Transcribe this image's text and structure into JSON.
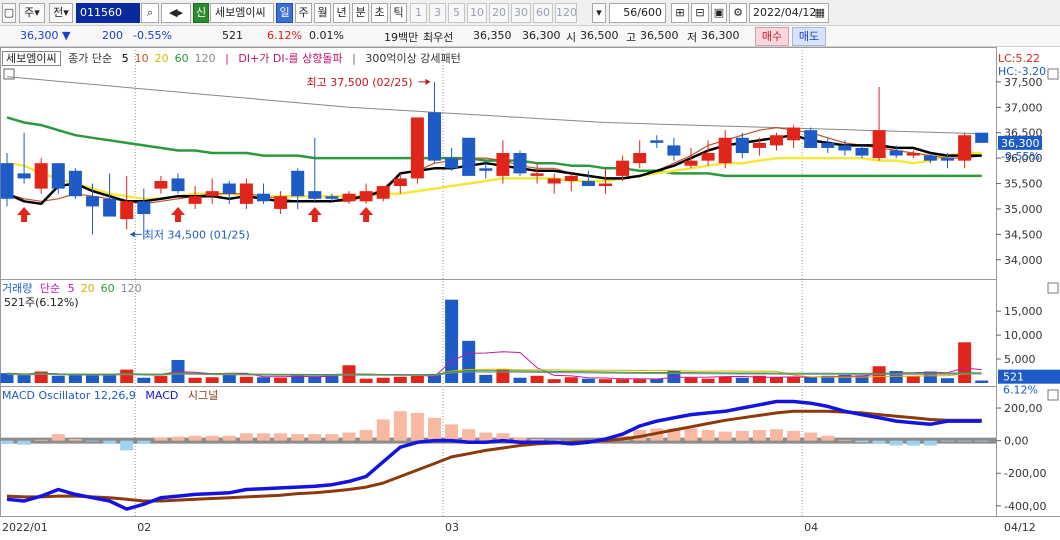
{
  "toolbar": {
    "market": "주",
    "type": "전",
    "code": "011560",
    "credit_badge": "신",
    "stock_name": "세보엠이씨",
    "period_tabs": [
      "일",
      "주",
      "월",
      "년",
      "분",
      "초",
      "틱"
    ],
    "selected_period": "일",
    "interval_buttons": [
      "1",
      "3",
      "5",
      "10",
      "20",
      "30",
      "60",
      "120"
    ],
    "count": "56/600",
    "date": "2022/04/12"
  },
  "quote": {
    "price": "36,300",
    "direction": "▼",
    "change": "200",
    "change_pct": "-0.55%",
    "volume": "521",
    "volume_pct": "6.12%",
    "turnover_pct": "0.01%",
    "unit": "19백만",
    "best_ask_label": "최우선",
    "best_ask": "36,350",
    "best_bid": "36,300",
    "open_label": "시",
    "open": "36,500",
    "high_label": "고",
    "high": "36,500",
    "low_label": "저",
    "low": "36,300",
    "buy_label": "매수",
    "sell_label": "매도"
  },
  "price_legend": {
    "name": "세보엠이씨",
    "ma_label": "종가 단순",
    "ma_periods": [
      "5",
      "10",
      "20",
      "60",
      "120"
    ],
    "signal1": "DI+가 DI-를 상향돌파",
    "signal2": "300억이상 강세패턴"
  },
  "volume_legend": {
    "label": "거래량",
    "ma_label": "단순",
    "ma_periods": [
      "5",
      "20",
      "60",
      "120"
    ],
    "current": "521주(6.12%)"
  },
  "macd_legend": {
    "label": "MACD Oscillator 12,26,9",
    "macd": "MACD",
    "signal": "시그널"
  },
  "right_labels": {
    "lc": "LC:5.22",
    "hc": "HC:-3.20",
    "price_tag": "36,300",
    "price_tag_pct": "-0.55%",
    "volume_tag": "521",
    "volume_tag_pct": "6.12%"
  },
  "annotations": {
    "high": "최고 37,500 (02/25)",
    "low": "최저 34,500 (01/25)"
  },
  "colors": {
    "up": "#e0251b",
    "down": "#1e5bc6",
    "ma5": "#000000",
    "ma10": "#c0502a",
    "ma20": "#f5e83a",
    "ma60": "#2c9a3c",
    "ma120": "#888888",
    "macd": "#1414e0",
    "signal": "#8b3a0c",
    "osc_pos": "#f7b9a2",
    "osc_neg": "#9fd2ef"
  },
  "chart_data": {
    "type": "candlestick",
    "price_axis": {
      "ticks": [
        34000,
        34500,
        35000,
        35500,
        36000,
        36500,
        37000,
        37500
      ],
      "tick_labels": [
        "34,000",
        "34,500",
        "35,000",
        "35,500",
        "36,000",
        "36,500",
        "37,000",
        "37,500"
      ],
      "range": [
        33700,
        37950
      ]
    },
    "volume_axis": {
      "ticks": [
        5000,
        10000,
        15000
      ],
      "tick_labels": [
        "5,000",
        "10,000",
        "15,000"
      ],
      "range": [
        0,
        19000
      ]
    },
    "macd_axis": {
      "ticks": [
        -400,
        -200,
        0,
        200
      ],
      "tick_labels": [
        "-400,00",
        "-200,00",
        "0,00",
        "200,00"
      ],
      "range": [
        -450,
        280
      ]
    },
    "date_axis": {
      "labels": [
        {
          "text": "2022/01",
          "index": -1
        },
        {
          "text": "02",
          "index": 8
        },
        {
          "text": "03",
          "index": 26
        },
        {
          "text": "04",
          "index": 47
        },
        {
          "text": "04/12",
          "index": 58
        }
      ]
    },
    "candles": [
      {
        "o": 35900,
        "h": 36100,
        "l": 35050,
        "c": 35200
      },
      {
        "o": 35700,
        "h": 36500,
        "l": 35500,
        "c": 35600
      },
      {
        "o": 35400,
        "h": 36000,
        "l": 35300,
        "c": 35900
      },
      {
        "o": 35900,
        "h": 35900,
        "l": 35300,
        "c": 35400
      },
      {
        "o": 35750,
        "h": 35800,
        "l": 35200,
        "c": 35250
      },
      {
        "o": 35250,
        "h": 35500,
        "l": 34500,
        "c": 35050
      },
      {
        "o": 35200,
        "h": 35700,
        "l": 35100,
        "c": 34850
      },
      {
        "o": 34800,
        "h": 35650,
        "l": 34600,
        "c": 35150
      },
      {
        "o": 35150,
        "h": 35400,
        "l": 34400,
        "c": 34900
      },
      {
        "o": 35400,
        "h": 35650,
        "l": 35300,
        "c": 35550
      },
      {
        "o": 35600,
        "h": 35700,
        "l": 35300,
        "c": 35350
      },
      {
        "o": 35100,
        "h": 35450,
        "l": 35000,
        "c": 35250
      },
      {
        "o": 35250,
        "h": 35600,
        "l": 35100,
        "c": 35350
      },
      {
        "o": 35500,
        "h": 35550,
        "l": 35100,
        "c": 35300
      },
      {
        "o": 35100,
        "h": 35600,
        "l": 35000,
        "c": 35500
      },
      {
        "o": 35300,
        "h": 35500,
        "l": 35100,
        "c": 35150
      },
      {
        "o": 35000,
        "h": 35350,
        "l": 34900,
        "c": 35250
      },
      {
        "o": 35750,
        "h": 35800,
        "l": 35000,
        "c": 35250
      },
      {
        "o": 35350,
        "h": 36400,
        "l": 35150,
        "c": 35200
      },
      {
        "o": 35250,
        "h": 35300,
        "l": 35150,
        "c": 35200
      },
      {
        "o": 35150,
        "h": 35350,
        "l": 35100,
        "c": 35300
      },
      {
        "o": 35150,
        "h": 35500,
        "l": 35100,
        "c": 35350
      },
      {
        "o": 35200,
        "h": 35400,
        "l": 35150,
        "c": 35450
      },
      {
        "o": 35450,
        "h": 35700,
        "l": 35300,
        "c": 35600
      },
      {
        "o": 35600,
        "h": 36100,
        "l": 35500,
        "c": 36800
      },
      {
        "o": 36900,
        "h": 37500,
        "l": 35900,
        "c": 35950
      },
      {
        "o": 36000,
        "h": 36200,
        "l": 35750,
        "c": 35800
      },
      {
        "o": 36400,
        "h": 36400,
        "l": 35800,
        "c": 35650
      },
      {
        "o": 35800,
        "h": 35950,
        "l": 35600,
        "c": 35750
      },
      {
        "o": 35650,
        "h": 36350,
        "l": 35500,
        "c": 36100
      },
      {
        "o": 36100,
        "h": 36150,
        "l": 35650,
        "c": 35700
      },
      {
        "o": 35650,
        "h": 35900,
        "l": 35500,
        "c": 35700
      },
      {
        "o": 35500,
        "h": 35700,
        "l": 35300,
        "c": 35600
      },
      {
        "o": 35550,
        "h": 35700,
        "l": 35350,
        "c": 35650
      },
      {
        "o": 35550,
        "h": 35750,
        "l": 35450,
        "c": 35450
      },
      {
        "o": 35450,
        "h": 35800,
        "l": 35300,
        "c": 35500
      },
      {
        "o": 35650,
        "h": 36050,
        "l": 35550,
        "c": 35950
      },
      {
        "o": 35900,
        "h": 36350,
        "l": 35800,
        "c": 36100
      },
      {
        "o": 36350,
        "h": 36450,
        "l": 36200,
        "c": 36300
      },
      {
        "o": 36250,
        "h": 36400,
        "l": 35950,
        "c": 36050
      },
      {
        "o": 35850,
        "h": 36200,
        "l": 35800,
        "c": 35950
      },
      {
        "o": 35950,
        "h": 36350,
        "l": 35850,
        "c": 36100
      },
      {
        "o": 35900,
        "h": 36550,
        "l": 35800,
        "c": 36400
      },
      {
        "o": 36400,
        "h": 36500,
        "l": 36000,
        "c": 36100
      },
      {
        "o": 36200,
        "h": 36400,
        "l": 36050,
        "c": 36300
      },
      {
        "o": 36250,
        "h": 36500,
        "l": 36150,
        "c": 36450
      },
      {
        "o": 36350,
        "h": 36650,
        "l": 36200,
        "c": 36600
      },
      {
        "o": 36550,
        "h": 36600,
        "l": 36200,
        "c": 36200
      },
      {
        "o": 36300,
        "h": 36400,
        "l": 36100,
        "c": 36200
      },
      {
        "o": 36250,
        "h": 36350,
        "l": 36050,
        "c": 36150
      },
      {
        "o": 36200,
        "h": 36250,
        "l": 36000,
        "c": 36050
      },
      {
        "o": 36000,
        "h": 37400,
        "l": 35950,
        "c": 36550
      },
      {
        "o": 36150,
        "h": 36250,
        "l": 36000,
        "c": 36050
      },
      {
        "o": 36050,
        "h": 36150,
        "l": 36000,
        "c": 36100
      },
      {
        "o": 36050,
        "h": 36100,
        "l": 35900,
        "c": 35950
      },
      {
        "o": 36000,
        "h": 36100,
        "l": 35800,
        "c": 35950
      },
      {
        "o": 35950,
        "h": 36500,
        "l": 35800,
        "c": 36450
      },
      {
        "o": 36500,
        "h": 36500,
        "l": 36300,
        "c": 36300
      }
    ],
    "volume": [
      2050,
      1650,
      2400,
      1500,
      1650,
      1800,
      1800,
      2800,
      1100,
      1450,
      4800,
      1100,
      1200,
      1700,
      1300,
      1200,
      1100,
      1600,
      1400,
      1700,
      3700,
      900,
      1100,
      1300,
      1500,
      1900,
      17400,
      8800,
      1700,
      2800,
      1100,
      1500,
      800,
      1200,
      900,
      800,
      800,
      800,
      900,
      2500,
      1100,
      900,
      1300,
      1100,
      1500,
      1200,
      1300,
      1200,
      1500,
      1700,
      1600,
      3500,
      2500,
      1400,
      2400,
      1000,
      8500,
      521
    ],
    "ma5": [
      35300,
      35150,
      35100,
      35450,
      35500,
      35350,
      35250,
      35150,
      35150,
      35200,
      35250,
      35250,
      35250,
      35200,
      35250,
      35200,
      35150,
      35150,
      35150,
      35150,
      35200,
      35250,
      35350,
      35700,
      35750,
      35800,
      35800,
      35850,
      35900,
      35850,
      35800,
      35750,
      35750,
      35700,
      35650,
      35600,
      35600,
      35650,
      35750,
      35850,
      36000,
      36150,
      36250,
      36300,
      36350,
      36400,
      36450,
      36350,
      36300,
      36250,
      36250,
      36250,
      36200,
      36200,
      36100,
      36050,
      36050,
      36050
    ],
    "ma10": [
      35300,
      35200,
      35150,
      35200,
      35300,
      35250,
      35200,
      35150,
      35100,
      35150,
      35200,
      35250,
      35300,
      35300,
      35300,
      35250,
      35200,
      35150,
      35150,
      35150,
      35150,
      35250,
      35400,
      35700,
      35750,
      35900,
      35950,
      36000,
      36000,
      35950,
      35850,
      35800,
      35800,
      35700,
      35650,
      35600,
      35600,
      35650,
      35750,
      35900,
      36050,
      36250,
      36350,
      36450,
      36550,
      36600,
      36550,
      36500,
      36400,
      36300,
      36250,
      36200,
      36150,
      36100,
      36050,
      36000,
      36000,
      36050
    ],
    "ma20": [
      35900,
      35850,
      35700,
      35600,
      35500,
      35400,
      35300,
      35250,
      35200,
      35200,
      35250,
      35300,
      35300,
      35300,
      35250,
      35250,
      35250,
      35250,
      35250,
      35250,
      35250,
      35250,
      35300,
      35300,
      35350,
      35400,
      35450,
      35500,
      35550,
      35600,
      35600,
      35600,
      35600,
      35550,
      35550,
      35550,
      35600,
      35650,
      35700,
      35750,
      35800,
      35850,
      35900,
      35900,
      35950,
      36000,
      36000,
      36000,
      36000,
      36000,
      36000,
      35950,
      35950,
      35900,
      35950,
      36050,
      36100,
      36100
    ],
    "ma60": [
      36800,
      36700,
      36650,
      36550,
      36450,
      36400,
      36350,
      36300,
      36250,
      36200,
      36150,
      36150,
      36100,
      36100,
      36100,
      36050,
      36050,
      36050,
      36000,
      36000,
      36000,
      36000,
      36000,
      36000,
      36000,
      36000,
      36000,
      36000,
      35950,
      35950,
      35950,
      35900,
      35900,
      35850,
      35850,
      35800,
      35800,
      35750,
      35750,
      35700,
      35700,
      35700,
      35650,
      35650,
      35650,
      35650,
      35650,
      35650,
      35650,
      35650,
      35650,
      35650,
      35650,
      35650,
      35650,
      35650,
      35650,
      35650
    ],
    "ma120": [
      37600,
      37570,
      37540,
      37510,
      37480,
      37450,
      37420,
      37390,
      37360,
      37330,
      37300,
      37270,
      37240,
      37210,
      37180,
      37150,
      37120,
      37090,
      37060,
      37030,
      37000,
      36980,
      36960,
      36940,
      36920,
      36900,
      36880,
      36860,
      36840,
      36820,
      36800,
      36780,
      36760,
      36740,
      36720,
      36700,
      36690,
      36680,
      36670,
      36660,
      36650,
      36640,
      36630,
      36620,
      36610,
      36600,
      36590,
      36580,
      36570,
      36560,
      36550,
      36540,
      36530,
      36520,
      36510,
      36500,
      36490,
      36480
    ],
    "macd": [
      -360,
      -370,
      -340,
      -300,
      -330,
      -350,
      -370,
      -420,
      -390,
      -350,
      -340,
      -330,
      -325,
      -320,
      -300,
      -295,
      -290,
      -285,
      -280,
      -270,
      -250,
      -220,
      -130,
      -40,
      -10,
      0,
      0,
      -10,
      -10,
      0,
      -10,
      -10,
      -10,
      -20,
      -10,
      10,
      40,
      90,
      120,
      140,
      160,
      170,
      180,
      200,
      220,
      240,
      240,
      230,
      210,
      180,
      160,
      140,
      120,
      110,
      100,
      120,
      120,
      120
    ],
    "signal": [
      -340,
      -345,
      -345,
      -340,
      -340,
      -345,
      -350,
      -360,
      -370,
      -370,
      -365,
      -360,
      -355,
      -350,
      -345,
      -340,
      -335,
      -325,
      -320,
      -310,
      -300,
      -285,
      -260,
      -220,
      -180,
      -140,
      -100,
      -80,
      -60,
      -45,
      -30,
      -20,
      -15,
      -10,
      -5,
      0,
      10,
      25,
      45,
      65,
      85,
      105,
      125,
      140,
      155,
      170,
      180,
      180,
      180,
      175,
      170,
      160,
      150,
      140,
      130,
      125,
      125,
      125
    ],
    "osc": [
      -20,
      -25,
      5,
      40,
      10,
      -5,
      -20,
      -60,
      -20,
      20,
      25,
      30,
      30,
      30,
      45,
      45,
      45,
      40,
      40,
      40,
      50,
      65,
      130,
      180,
      170,
      140,
      100,
      70,
      50,
      45,
      20,
      10,
      5,
      -10,
      -5,
      10,
      30,
      65,
      75,
      75,
      75,
      65,
      55,
      60,
      65,
      70,
      60,
      50,
      30,
      5,
      -10,
      -20,
      -30,
      -30,
      -30,
      -5,
      -5,
      -5
    ],
    "buy_signals": [
      1,
      10,
      18,
      21
    ]
  }
}
